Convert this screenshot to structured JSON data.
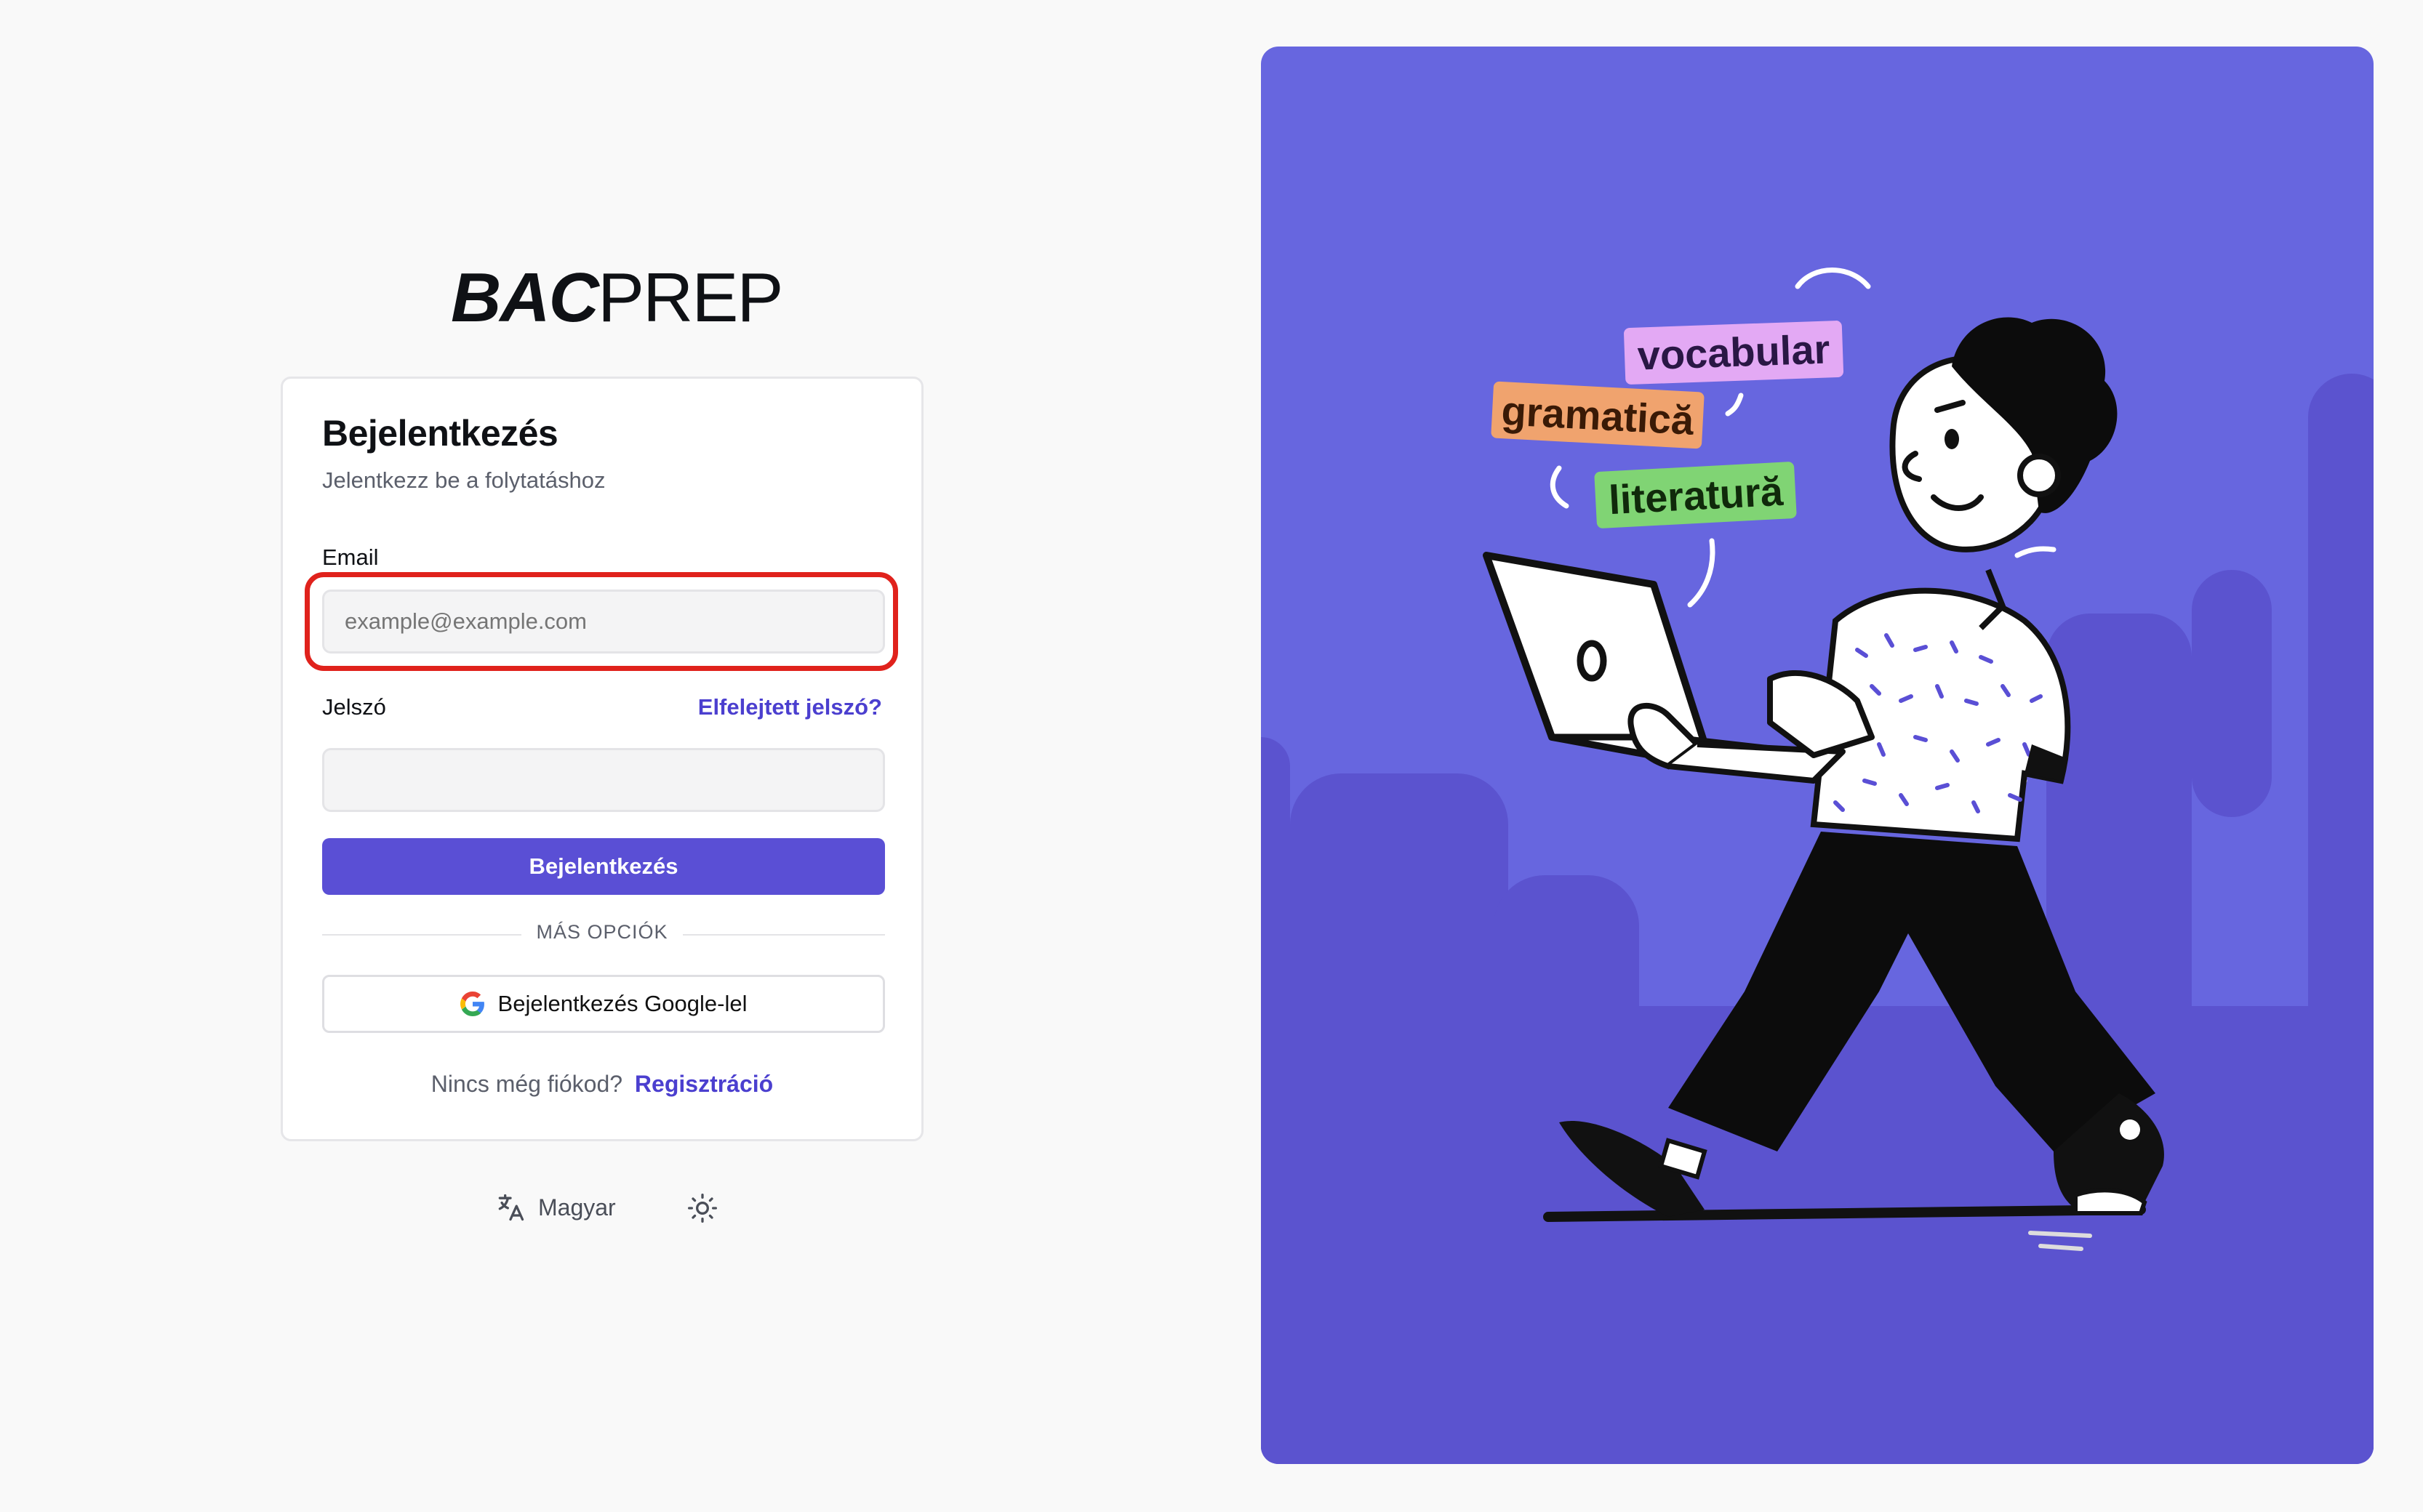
{
  "brand": {
    "logo_bold": "BAC",
    "logo_light": "PREP"
  },
  "login": {
    "title": "Bejelentkezés",
    "subtitle": "Jelentkezz be a folytatáshoz",
    "email_label": "Email",
    "email_placeholder": "example@example.com",
    "email_value": "",
    "password_label": "Jelszó",
    "forgot_password": "Elfelejtett jelszó?",
    "password_value": "",
    "submit_label": "Bejelentkezés",
    "divider_label": "MÁS OPCIÓK",
    "google_label": "Bejelentkezés Google-lel",
    "no_account_text": "Nincs még fiókod?",
    "signup_link": "Regisztráció"
  },
  "footer": {
    "language_label": "Magyar",
    "language_icon": "translate-icon",
    "theme_icon": "sun-icon"
  },
  "illustration": {
    "tags": [
      "vocabular",
      "gramatică",
      "literatură"
    ]
  },
  "colors": {
    "accent": "#5a4fd5",
    "link": "#4b3fcf",
    "panel_bg": "#6766df",
    "highlight": "#e0221c",
    "tag_vocabular": "#e0a6f2",
    "tag_gramatica": "#f0a06a",
    "tag_literatura": "#7fd473"
  }
}
